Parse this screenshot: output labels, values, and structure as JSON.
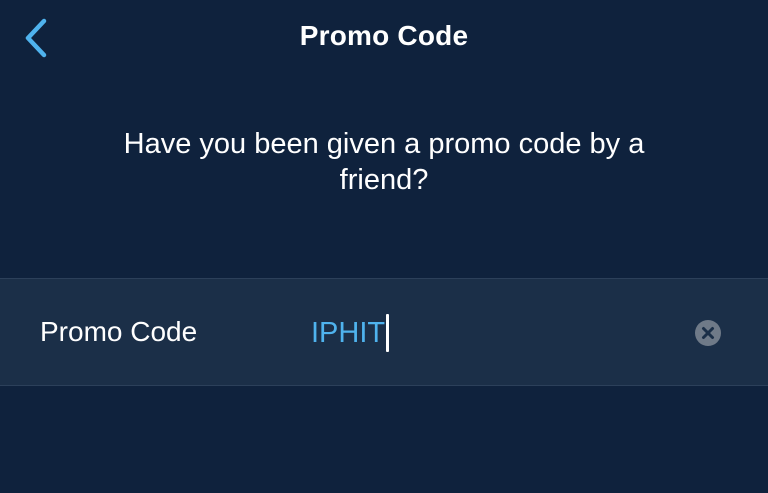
{
  "nav": {
    "title": "Promo Code",
    "back_icon": "chevron-left-icon"
  },
  "prompt": {
    "text": "Have you been given a promo code by a friend?"
  },
  "promo_field": {
    "label": "Promo Code",
    "value": "IPHIT",
    "clear_icon": "clear-circle-icon"
  },
  "colors": {
    "background": "#0f223d",
    "field_background": "#1b2f48",
    "accent": "#4fb3ee",
    "text": "#ffffff",
    "clear_icon": "#6f7a88"
  }
}
